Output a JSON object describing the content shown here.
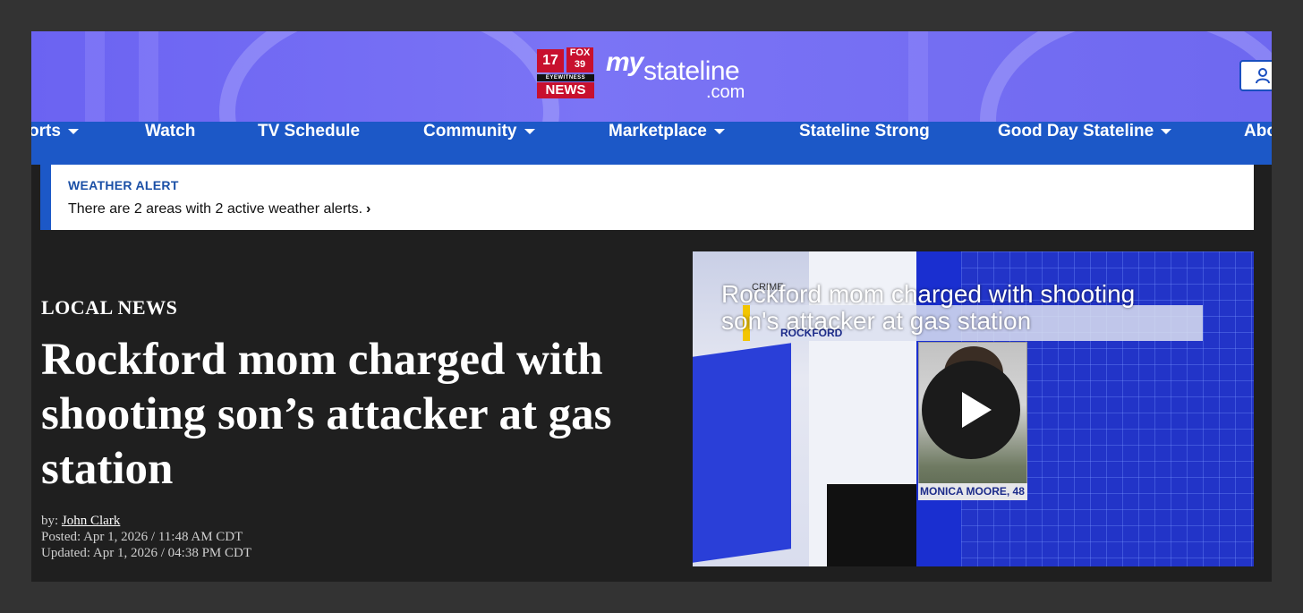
{
  "brand": {
    "logo_17": "17",
    "logo_fox": "FOX 39",
    "logo_eyewitness": "EYEWITNESS",
    "logo_news": "NEWS",
    "wordmark_my": "my",
    "wordmark_stateline": "stateline",
    "wordmark_com": ".com",
    "user_icon": "user-icon"
  },
  "nav": {
    "items": [
      {
        "label": "orts",
        "dropdown": true
      },
      {
        "label": "Watch",
        "dropdown": false
      },
      {
        "label": "TV Schedule",
        "dropdown": false
      },
      {
        "label": "Community",
        "dropdown": true
      },
      {
        "label": "Marketplace",
        "dropdown": true
      },
      {
        "label": "Stateline Strong",
        "dropdown": false
      },
      {
        "label": "Good Day Stateline",
        "dropdown": true
      },
      {
        "label": "Abo",
        "dropdown": false
      }
    ]
  },
  "alert": {
    "title": "WEATHER ALERT",
    "text": "There are 2 areas with 2 active weather alerts.",
    "chevron": "›"
  },
  "article": {
    "kicker": "LOCAL NEWS",
    "headline": "Rockford mom charged with shooting son’s attacker at gas station",
    "by_prefix": "by: ",
    "author": "John Clark",
    "posted": "Posted: Apr 1, 2026 / 11:48 AM CDT",
    "updated": "Updated: Apr 1, 2026 / 04:38 PM CDT"
  },
  "video": {
    "title": "Rockford mom charged with shooting son's attacker at gas station",
    "graphic_crime": "CRIME",
    "graphic_location": "ROCKFORD",
    "graphic_name": "MONICA MOORE, 48",
    "play_icon": "play-icon"
  },
  "colors": {
    "nav_bg": "#1c58c7",
    "alert_title": "#1a4fa6",
    "page_bg": "#1f1f1f"
  }
}
